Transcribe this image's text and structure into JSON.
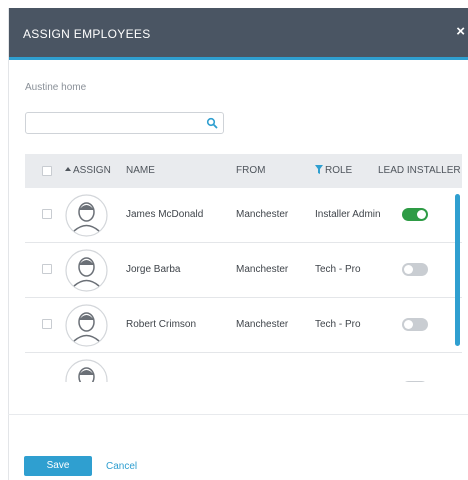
{
  "modal": {
    "title": "ASSIGN EMPLOYEES",
    "close_label": "×",
    "subtitle": "Austine home"
  },
  "search": {
    "value": "",
    "placeholder": "",
    "icon": "search-icon"
  },
  "table": {
    "headers": {
      "assign": "ASSIGN",
      "name": "NAME",
      "from": "FROM",
      "role": "ROLE",
      "lead_installer": "LEAD INSTALLER"
    },
    "rows": [
      {
        "name": "James McDonald",
        "from": "Manchester",
        "role": "Installer Admin",
        "lead_installer": true
      },
      {
        "name": "Jorge Barba",
        "from": "Manchester",
        "role": "Tech - Pro",
        "lead_installer": false
      },
      {
        "name": "Robert Crimson",
        "from": "Manchester",
        "role": "Tech - Pro",
        "lead_installer": false
      }
    ]
  },
  "footer": {
    "save_label": "Save",
    "cancel_label": "Cancel"
  },
  "colors": {
    "header_bg": "#4a5563",
    "accent": "#2f9fd0",
    "toggle_on": "#2e9b45",
    "toggle_off": "#c9cdd2"
  }
}
